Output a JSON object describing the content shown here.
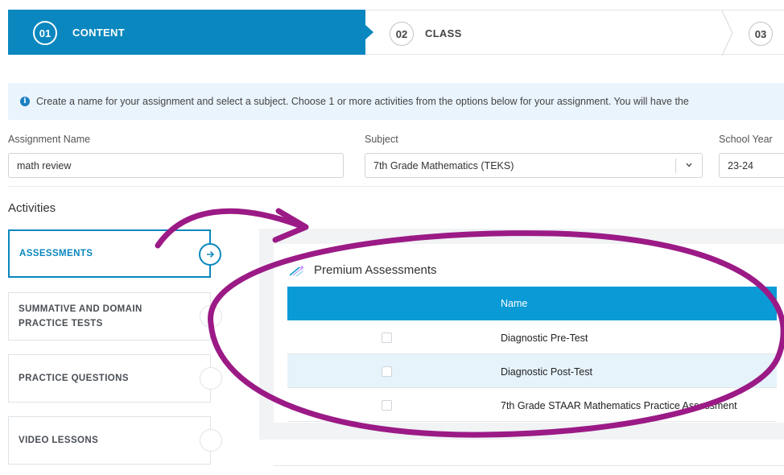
{
  "stepper": {
    "steps": [
      {
        "num": "01",
        "label": "CONTENT"
      },
      {
        "num": "02",
        "label": "CLASS"
      },
      {
        "num": "03",
        "label": ""
      }
    ]
  },
  "info": {
    "text": "Create a name for your assignment and select a subject. Choose 1 or more activities from the options below for your assignment. You will have the"
  },
  "form": {
    "assignment_name_label": "Assignment Name",
    "assignment_name_value": "math review",
    "subject_label": "Subject",
    "subject_value": "7th Grade Mathematics (TEKS)",
    "school_year_label": "School Year",
    "school_year_value": "23-24"
  },
  "activities": {
    "title": "Activities",
    "items": [
      {
        "label": "ASSESSMENTS"
      },
      {
        "line1": "SUMMATIVE AND DOMAIN",
        "line2": "PRACTICE TESTS"
      },
      {
        "label": "PRACTICE QUESTIONS"
      },
      {
        "label": "VIDEO LESSONS"
      }
    ]
  },
  "premium": {
    "title": "Premium Assessments",
    "column_name": "Name",
    "rows": [
      {
        "name": "Diagnostic Pre-Test"
      },
      {
        "name": "Diagnostic Post-Test"
      },
      {
        "name": "7th Grade STAAR Mathematics Practice Assessment"
      }
    ]
  },
  "colors": {
    "primary": "#0a87bf",
    "table_header": "#0a9bd6",
    "info_bg": "#eaf4fc",
    "annotation": "#9b1a86"
  }
}
